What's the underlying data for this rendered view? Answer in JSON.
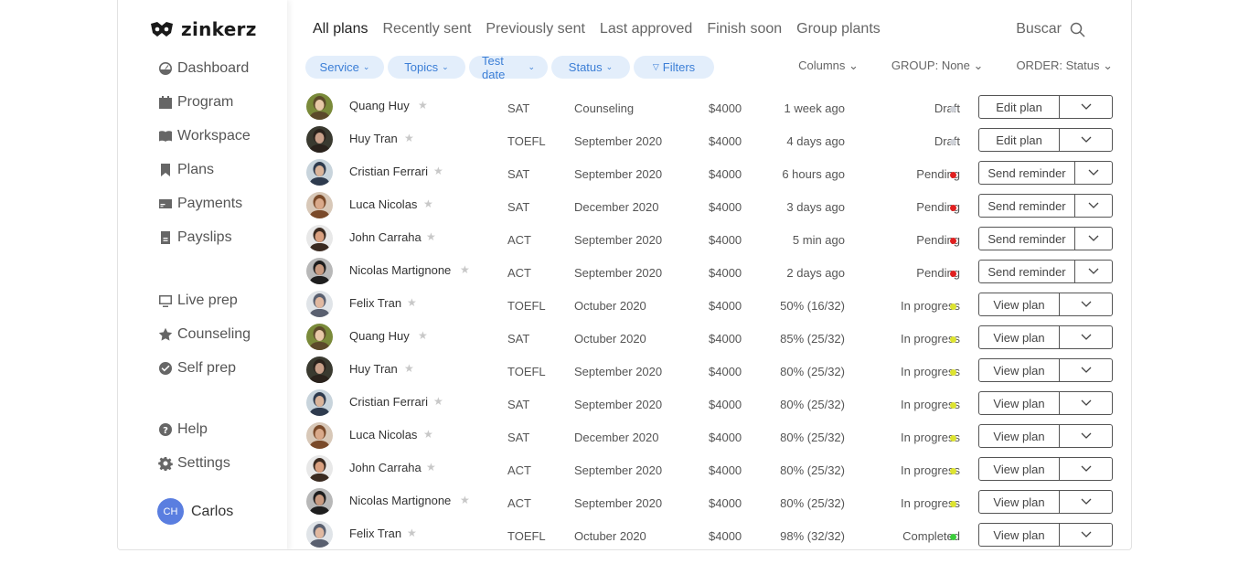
{
  "brand": {
    "name": "zinkerz"
  },
  "sidebar": {
    "items": [
      {
        "label": "Dashboard",
        "icon": "dashboard-icon"
      },
      {
        "label": "Program",
        "icon": "calendar-icon"
      },
      {
        "label": "Workspace",
        "icon": "book-icon"
      },
      {
        "label": "Plans",
        "icon": "bookmark-icon"
      },
      {
        "label": "Payments",
        "icon": "card-icon"
      },
      {
        "label": "Payslips",
        "icon": "receipt-icon"
      }
    ],
    "items2": [
      {
        "label": "Live prep",
        "icon": "monitor-icon"
      },
      {
        "label": "Counseling",
        "icon": "star-icon"
      },
      {
        "label": "Self prep",
        "icon": "check-circle-icon"
      }
    ],
    "items3": [
      {
        "label": "Help",
        "icon": "help-icon"
      },
      {
        "label": "Settings",
        "icon": "gear-icon"
      }
    ],
    "user": {
      "initials": "CH",
      "name": "Carlos"
    }
  },
  "tabs": [
    "All plans",
    "Recently sent",
    "Previously sent",
    "Last approved",
    "Finish soon",
    "Group plants"
  ],
  "search": {
    "label": "Buscar"
  },
  "filters": {
    "chips": [
      "Service",
      "Topics",
      "Test date",
      "Status",
      "Filters"
    ],
    "columns": "Columns",
    "group": "GROUP: None",
    "order": "ORDER: Status"
  },
  "colors": {
    "draft": "#cfd2d8",
    "pending": "#e02020",
    "in_progress": "#dde330",
    "completed": "#3ccd3c",
    "chip_bg": "#e3eefb",
    "chip_text": "#3b7ed6"
  },
  "rows": [
    {
      "name": "Quang Huy",
      "test": "SAT",
      "topic": "Counseling",
      "price": "$4000",
      "time": "1 week ago",
      "status": "Draft",
      "action": "Edit plan"
    },
    {
      "name": "Huy Tran",
      "test": "TOEFL",
      "topic": "September 2020",
      "price": "$4000",
      "time": "4 days ago",
      "status": "Draft",
      "action": "Edit plan"
    },
    {
      "name": "Cristian Ferrari",
      "test": "SAT",
      "topic": "September 2020",
      "price": "$4000",
      "time": "6 hours ago",
      "status": "Pending",
      "action": "Send reminder"
    },
    {
      "name": "Luca Nicolas",
      "test": "SAT",
      "topic": "December 2020",
      "price": "$4000",
      "time": "3 days ago",
      "status": "Pending",
      "action": "Send reminder"
    },
    {
      "name": "John Carraha",
      "test": "ACT",
      "topic": "September 2020",
      "price": "$4000",
      "time": "5 min ago",
      "status": "Pending",
      "action": "Send reminder"
    },
    {
      "name": "Nicolas Martignone",
      "test": "ACT",
      "topic": "September 2020",
      "price": "$4000",
      "time": "2 days ago",
      "status": "Pending",
      "action": "Send reminder"
    },
    {
      "name": "Felix Tran",
      "test": "TOEFL",
      "topic": "Octuber 2020",
      "price": "$4000",
      "time": "50% (16/32)",
      "status": "In progress",
      "action": "View plan"
    },
    {
      "name": "Quang Huy",
      "test": "SAT",
      "topic": "Octuber 2020",
      "price": "$4000",
      "time": "85% (25/32)",
      "status": "In progress",
      "action": "View plan"
    },
    {
      "name": "Huy Tran",
      "test": "TOEFL",
      "topic": "September 2020",
      "price": "$4000",
      "time": "80% (25/32)",
      "status": "In progress",
      "action": "View plan"
    },
    {
      "name": "Cristian Ferrari",
      "test": "SAT",
      "topic": "September 2020",
      "price": "$4000",
      "time": "80% (25/32)",
      "status": "In progress",
      "action": "View plan"
    },
    {
      "name": "Luca Nicolas",
      "test": "SAT",
      "topic": "December 2020",
      "price": "$4000",
      "time": "80% (25/32)",
      "status": "In progress",
      "action": "View plan"
    },
    {
      "name": "John Carraha",
      "test": "ACT",
      "topic": "September 2020",
      "price": "$4000",
      "time": "80% (25/32)",
      "status": "In progress",
      "action": "View plan"
    },
    {
      "name": "Nicolas Martignone",
      "test": "ACT",
      "topic": "September 2020",
      "price": "$4000",
      "time": "80% (25/32)",
      "status": "In progress",
      "action": "View plan"
    },
    {
      "name": "Felix Tran",
      "test": "TOEFL",
      "topic": "Octuber 2020",
      "price": "$4000",
      "time": "98% (32/32)",
      "status": "Completed",
      "action": "View plan"
    }
  ]
}
